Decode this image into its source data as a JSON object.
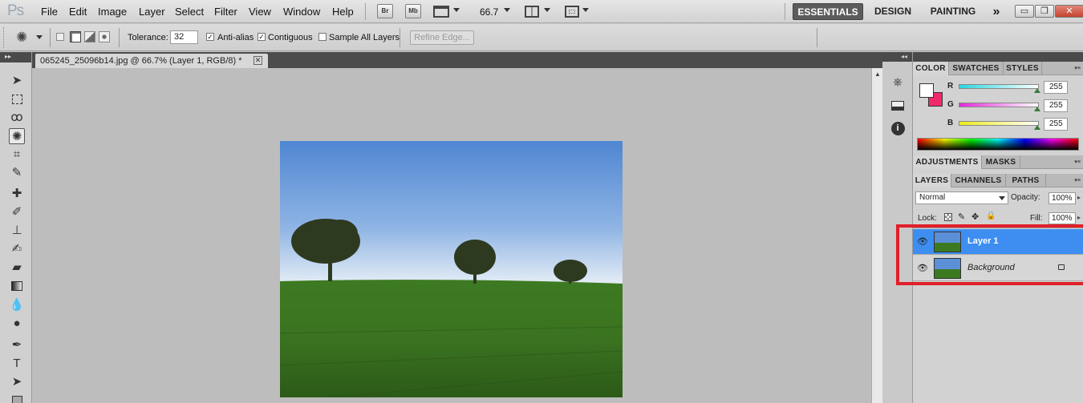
{
  "app": {
    "logo": "Ps"
  },
  "menu": [
    "File",
    "Edit",
    "Image",
    "Layer",
    "Select",
    "Filter",
    "View",
    "Window",
    "Help"
  ],
  "appbar": {
    "bridge": "Br",
    "minibridge": "Mb",
    "zoom": "66.7"
  },
  "workspaces": [
    "ESSENTIALS",
    "DESIGN",
    "PAINTING"
  ],
  "workspace_more": "»",
  "window_controls": {
    "minimize": "▭",
    "restore": "❐",
    "close": "✕"
  },
  "options": {
    "tolerance_label": "Tolerance:",
    "tolerance_value": "32",
    "antialias_label": "Anti-alias",
    "contiguous_label": "Contiguous",
    "sample_all_label": "Sample All Layers",
    "refine_edge_label": "Refine Edge..."
  },
  "document": {
    "tab_title": "065245_25096b14.jpg @ 66.7% (Layer 1, RGB/8) *",
    "close": "✕"
  },
  "panels": {
    "color_tabs": [
      "COLOR",
      "SWATCHES",
      "STYLES"
    ],
    "channels": [
      {
        "name": "R",
        "value": "255",
        "gradient": "linear-gradient(to right, #2ad6e0, #ffffff)"
      },
      {
        "name": "G",
        "value": "255",
        "gradient": "linear-gradient(to right, #e02ad8, #ffffff)"
      },
      {
        "name": "B",
        "value": "255",
        "gradient": "linear-gradient(to right, #ecec1c, #ffffff)"
      }
    ],
    "foreground_color": "#ffffff",
    "background_color": "#f02a6a",
    "adjust_tabs": [
      "ADJUSTMENTS",
      "MASKS"
    ],
    "layer_tabs": [
      "LAYERS",
      "CHANNELS",
      "PATHS"
    ],
    "blend_mode": "Normal",
    "opacity_label": "Opacity:",
    "opacity_value": "100%",
    "lock_label": "Lock:",
    "fill_label": "Fill:",
    "fill_value": "100%",
    "layers": [
      {
        "name": "Layer 1",
        "selected": true,
        "locked": false
      },
      {
        "name": "Background",
        "selected": false,
        "locked": true
      }
    ]
  },
  "colors": {
    "selection": "#3d8ef0",
    "highlight": "#e0202a"
  }
}
